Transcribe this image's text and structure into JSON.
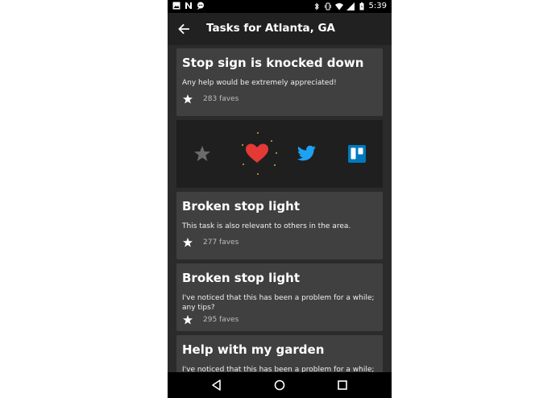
{
  "status_bar": {
    "time": "5:39",
    "left_icons": [
      "image-icon",
      "n-icon",
      "chat-icon"
    ],
    "right_icons": [
      "bluetooth-icon",
      "vibrate-icon",
      "wifi-icon",
      "signal-icon",
      "battery-icon"
    ]
  },
  "app_bar": {
    "title": "Tasks for Atlanta, GA",
    "back_icon": "arrow-back-icon"
  },
  "tasks": [
    {
      "title": "Stop sign is knocked down",
      "description": "Any help would be extremely appreciated!",
      "faves": "283 faves"
    },
    {
      "title": "Broken stop light",
      "description": "This task is also relevant to others in the area.",
      "faves": "277 faves"
    },
    {
      "title": "Broken stop light",
      "description": "I've noticed that this has been a problem for a while; any tips?",
      "faves": "295 faves"
    },
    {
      "title": "Help with my garden",
      "description": "I've noticed that this has been a problem for a while; any tips?"
    }
  ],
  "share_panel": {
    "icons": [
      "star-icon",
      "heart-icon",
      "twitter-icon",
      "trello-icon"
    ],
    "colors": {
      "star": "#6b6b6b",
      "heart": "#e53935",
      "twitter": "#1da1f2",
      "trello": "#0079bf",
      "sparkle": "#e6a23c"
    }
  },
  "nav_bar": {
    "icons": [
      "back-triangle-icon",
      "home-circle-icon",
      "recents-square-icon"
    ]
  }
}
